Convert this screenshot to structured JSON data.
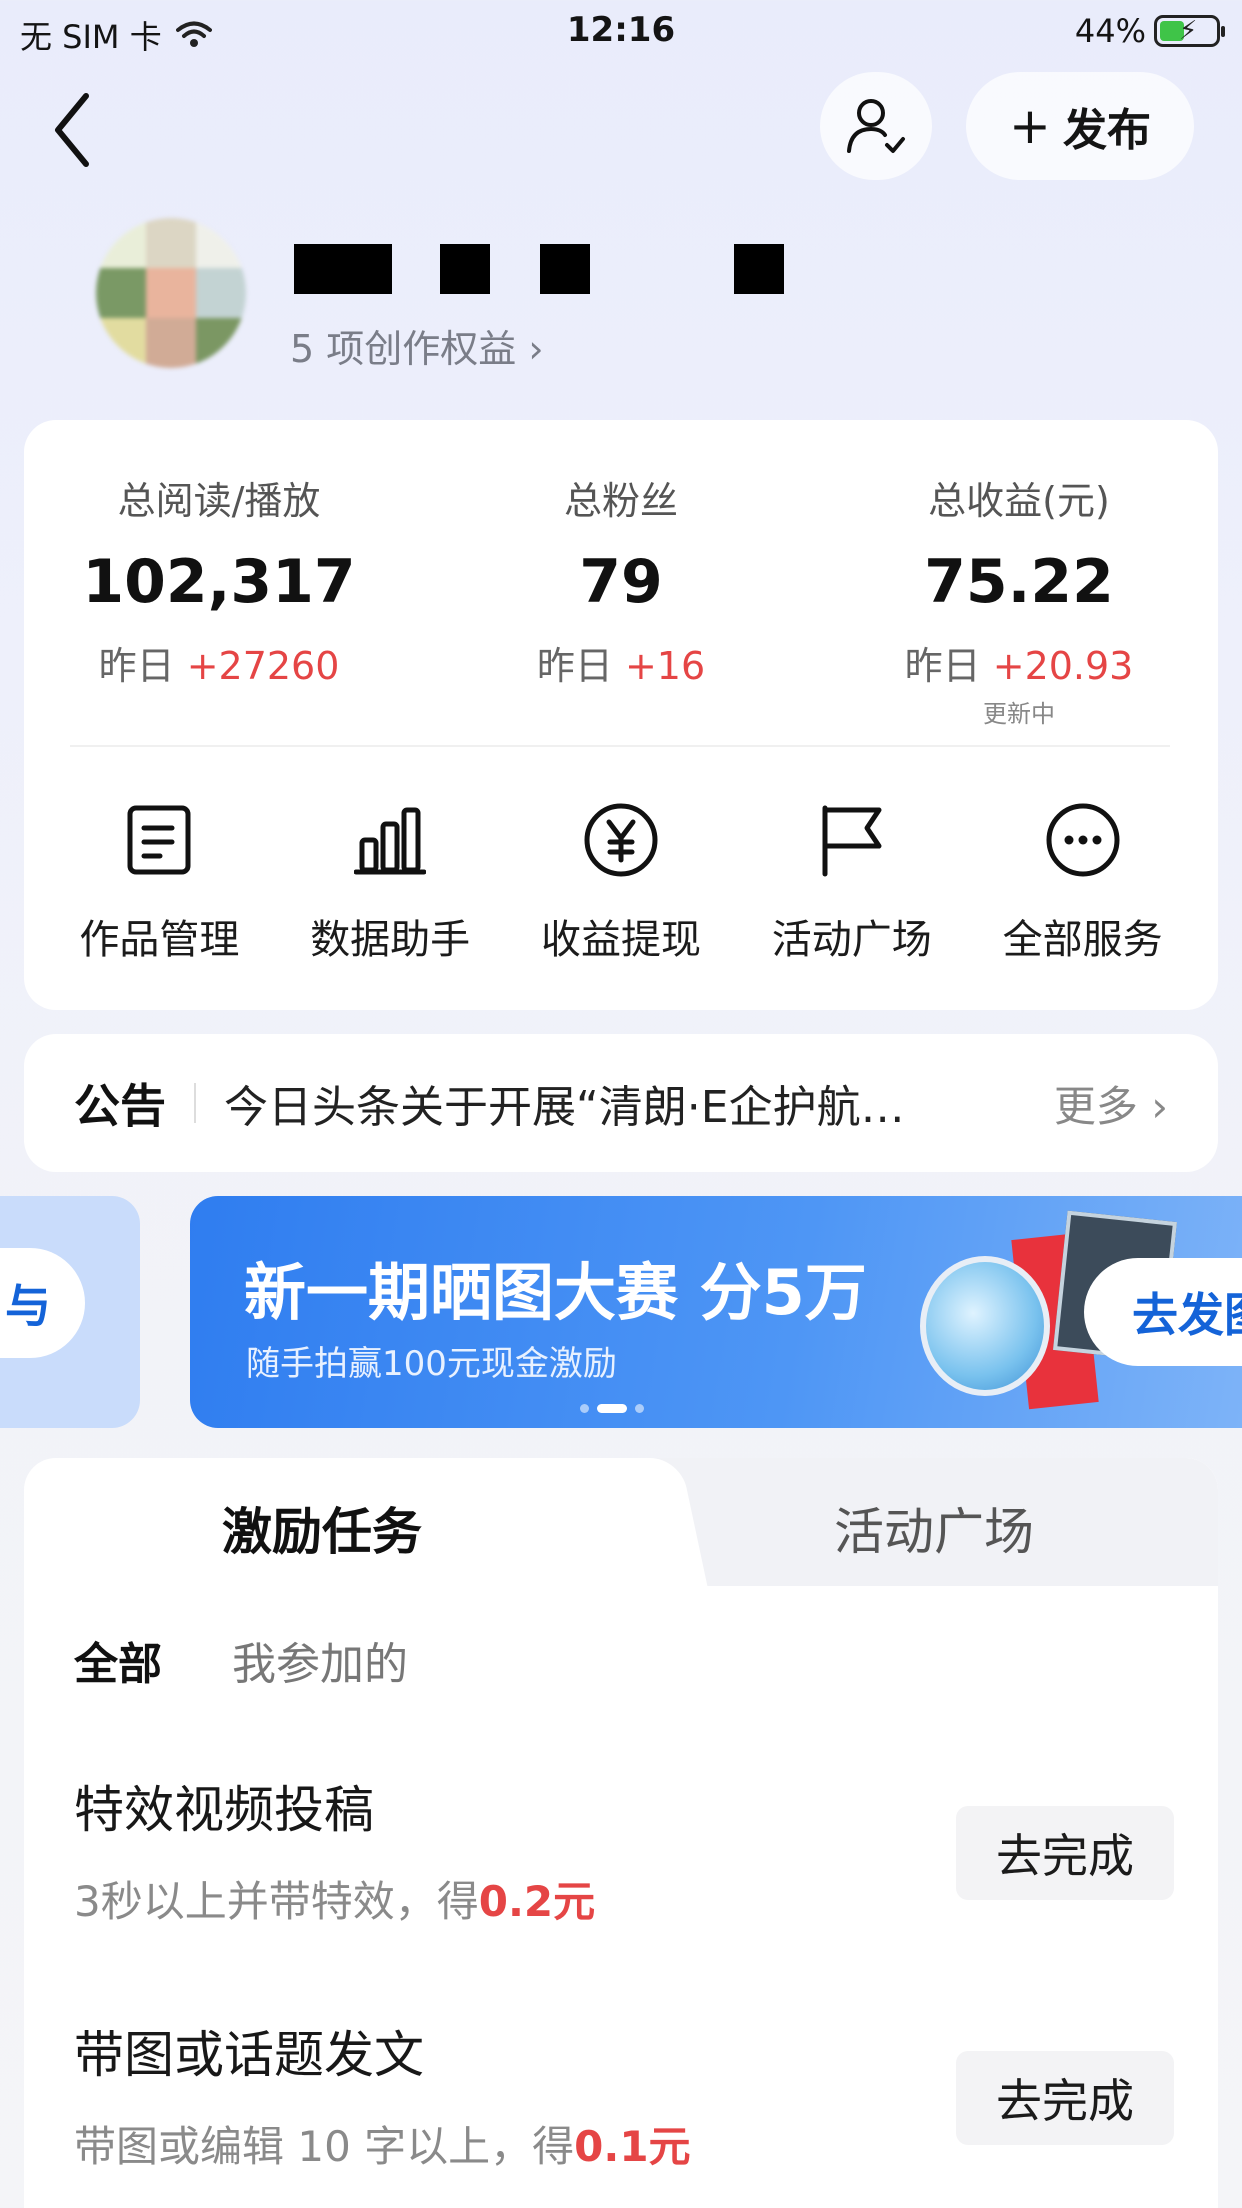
{
  "status_bar": {
    "carrier": "无 SIM 卡",
    "time": "12:16",
    "battery_percent": "44%"
  },
  "nav": {
    "publish_label": "发布"
  },
  "profile": {
    "perks_text": "5 项创作权益"
  },
  "stats": [
    {
      "label": "总阅读/播放",
      "value": "102,317",
      "delta_prefix": "昨日",
      "delta": "+27260",
      "note": ""
    },
    {
      "label": "总粉丝",
      "value": "79",
      "delta_prefix": "昨日",
      "delta": "+16",
      "note": ""
    },
    {
      "label": "总收益(元)",
      "value": "75.22",
      "delta_prefix": "昨日",
      "delta": "+20.93",
      "note": "更新中"
    }
  ],
  "services": [
    {
      "label": "作品管理",
      "icon": "document-icon"
    },
    {
      "label": "数据助手",
      "icon": "bar-chart-icon"
    },
    {
      "label": "收益提现",
      "icon": "yen-icon"
    },
    {
      "label": "活动广场",
      "icon": "flag-icon"
    },
    {
      "label": "全部服务",
      "icon": "more-icon"
    }
  ],
  "notice": {
    "tag": "公告",
    "text": "今日头条关于开展“清朗·E企护航…",
    "more": "更多"
  },
  "banner": {
    "prev_pill": "与",
    "title": "新一期晒图大赛 分5万",
    "subtitle": "随手拍赢100元现金激励",
    "action": "去发图"
  },
  "tasks": {
    "tabs": [
      "激励任务",
      "活动广场"
    ],
    "filters": [
      "全部",
      "我参加的"
    ],
    "items": [
      {
        "title": "特效视频投稿",
        "desc": "3秒以上并带特效，得",
        "reward": "0.2元",
        "action": "去完成"
      },
      {
        "title": "带图或话题发文",
        "desc": "带图或编辑 10 字以上，得",
        "reward": "0.1元",
        "action": "去完成"
      }
    ]
  },
  "colors": {
    "accent_red": "#e54545",
    "brand_blue": "#1463d8"
  }
}
